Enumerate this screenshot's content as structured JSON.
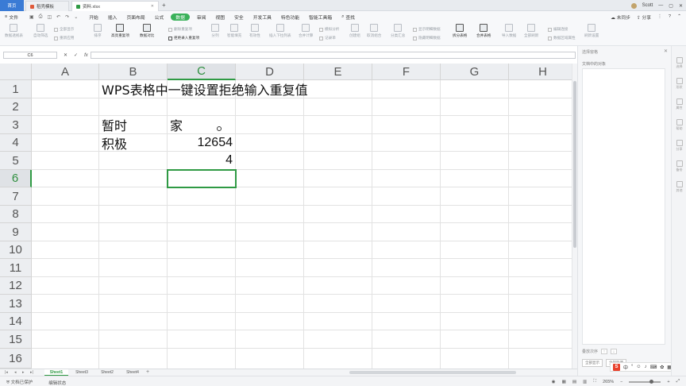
{
  "titlebar": {
    "home_tab": "首页",
    "tabs": [
      {
        "label": "稻壳模板"
      },
      {
        "label": "资料.xlsx"
      }
    ],
    "new_tab": "+",
    "user": "Scott"
  },
  "menubar": {
    "file": "文件",
    "items": [
      "开始",
      "插入",
      "页面布局",
      "公式",
      "数据",
      "审阅",
      "视图",
      "安全",
      "开发工具",
      "特色功能",
      "智能工具箱"
    ],
    "active": "数据",
    "search": "查找",
    "sync": "未同步",
    "share": "分享"
  },
  "ribbon": {
    "pivot": "数据透视表",
    "autofilter": "自动筛选",
    "all_show": "全部显示",
    "reapply": "重新应用",
    "sort": "排序",
    "highlight_dup": "高亮重复项",
    "compare": "数据对比",
    "remove_dup": "删除重复项",
    "reject_dup": "拒绝录入重复项",
    "split": "分列",
    "smart_fill": "智能填充",
    "validity": "有效性",
    "dropdown": "插入下拉列表",
    "consolidate": "合并计算",
    "simulate": "模拟分析",
    "record": "记录单",
    "group": "创建组",
    "ungroup": "取消组合",
    "subtotal": "分类汇总",
    "show_detail": "显示明细数据",
    "hide_detail": "隐藏明细数据",
    "split_sheet": "拆分表格",
    "merge_sheet": "合并表格",
    "import": "导入数据",
    "refresh_all": "全部刷新",
    "edit_links": "编辑连接",
    "data_props": "数据区域属性",
    "refresh_settings": "刷新设置"
  },
  "formula_bar": {
    "name_box": "C6",
    "cancel": "✕",
    "confirm": "✓",
    "fx": "fx",
    "value": ""
  },
  "grid": {
    "columns": [
      "A",
      "B",
      "C",
      "D",
      "E",
      "F",
      "G",
      "H"
    ],
    "selected_column": "C",
    "rows": [
      "1",
      "2",
      "3",
      "4",
      "5",
      "6",
      "7",
      "8",
      "9",
      "10",
      "11",
      "12",
      "13",
      "14",
      "15",
      "16"
    ],
    "selected_row": "6",
    "cells": {
      "B1": "WPS表格中一键设置拒绝输入重复值",
      "B3": "暂时",
      "C3": "家",
      "B4": "积极",
      "C4": "12654",
      "C5": "4"
    }
  },
  "sheets": {
    "tabs": [
      "Sheet1",
      "Sheet3",
      "Sheet2",
      "Sheet4"
    ],
    "active": "Sheet1",
    "add": "+"
  },
  "statusbar": {
    "protect": "文档已保护",
    "mode": "编辑状态",
    "zoom": "265%"
  },
  "pane": {
    "title": "选择窗格",
    "subtitle": "文档中的对象",
    "order_label": "叠放次序",
    "show_all": "全部显示",
    "hide_all": "全部隐藏"
  },
  "right_sidebar": [
    "选择",
    "形状",
    "属性",
    "帮助",
    "分享",
    "备份",
    "其他"
  ],
  "ime": {
    "logo": "S",
    "lang": "中"
  },
  "colors": {
    "accent_green": "#2f9a44",
    "home_blue": "#3a7bd5",
    "active_menu": "#3ab15a"
  }
}
